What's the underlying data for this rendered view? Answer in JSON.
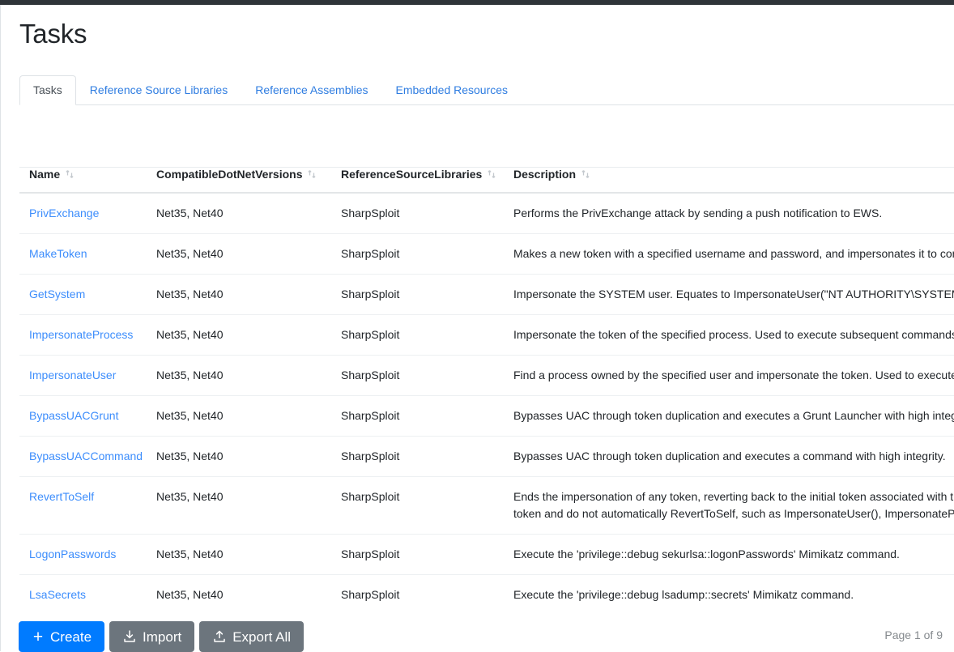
{
  "navbar": {
    "color": "#2f3439"
  },
  "page": {
    "title": "Tasks"
  },
  "tabs": [
    {
      "label": "Tasks",
      "active": true
    },
    {
      "label": "Reference Source Libraries",
      "active": false
    },
    {
      "label": "Reference Assemblies",
      "active": false
    },
    {
      "label": "Embedded Resources",
      "active": false
    }
  ],
  "table": {
    "columns": [
      {
        "label": "Name",
        "sort_icon": "sort-updown-icon"
      },
      {
        "label": "CompatibleDotNetVersions",
        "sort_icon": "sort-updown-icon"
      },
      {
        "label": "ReferenceSourceLibraries",
        "sort_icon": "sort-updown-icon"
      },
      {
        "label": "Description",
        "sort_icon": "sort-updown-icon"
      }
    ],
    "rows": [
      {
        "name": "PrivExchange",
        "versions": "Net35, Net40",
        "libraries": "SharpSploit",
        "description": "Performs the PrivExchange attack by sending a push notification to EWS."
      },
      {
        "name": "MakeToken",
        "versions": "Net35, Net40",
        "libraries": "SharpSploit",
        "description": "Makes a new token with a specified username and password, and impersonates it to conduct future actions."
      },
      {
        "name": "GetSystem",
        "versions": "Net35, Net40",
        "libraries": "SharpSploit",
        "description": "Impersonate the SYSTEM user. Equates to ImpersonateUser(\"NT AUTHORITY\\SYSTEM\")."
      },
      {
        "name": "ImpersonateProcess",
        "versions": "Net35, Net40",
        "libraries": "SharpSploit",
        "description": "Impersonate the token of the specified process. Used to execute subsequent commands as the user associated with the token of the specified process."
      },
      {
        "name": "ImpersonateUser",
        "versions": "Net35, Net40",
        "libraries": "SharpSploit",
        "description": "Find a process owned by the specified user and impersonate the token. Used to execute subsequent commands as the specified user."
      },
      {
        "name": "BypassUACGrunt",
        "versions": "Net35, Net40",
        "libraries": "SharpSploit",
        "description": "Bypasses UAC through token duplication and executes a Grunt Launcher with high integrity."
      },
      {
        "name": "BypassUACCommand",
        "versions": "Net35, Net40",
        "libraries": "SharpSploit",
        "description": "Bypasses UAC through token duplication and executes a command with high integrity."
      },
      {
        "name": "RevertToSelf",
        "versions": "Net35, Net40",
        "libraries": "SharpSploit",
        "description": "Ends the impersonation of any token, reverting back to the initial token associated with the current process. Useful in conjunction with functions that impersonate a token and do not automatically RevertToSelf, such as ImpersonateUser(), ImpersonateProcess(), MakeToken(), and GetSystem()."
      },
      {
        "name": "LogonPasswords",
        "versions": "Net35, Net40",
        "libraries": "SharpSploit",
        "description": "Execute the 'privilege::debug sekurlsa::logonPasswords' Mimikatz command."
      },
      {
        "name": "LsaSecrets",
        "versions": "Net35, Net40",
        "libraries": "SharpSploit",
        "description": "Execute the 'privilege::debug lsadump::secrets' Mimikatz command."
      }
    ]
  },
  "toolbar": {
    "create_label": "Create",
    "create_icon": "plus-icon",
    "import_label": "Import",
    "import_icon": "download-icon",
    "export_label": "Export All",
    "export_icon": "upload-icon",
    "primary_color": "#007bff",
    "secondary_color": "#6c757d"
  },
  "pagination": {
    "text": "Page 1 of 9"
  }
}
